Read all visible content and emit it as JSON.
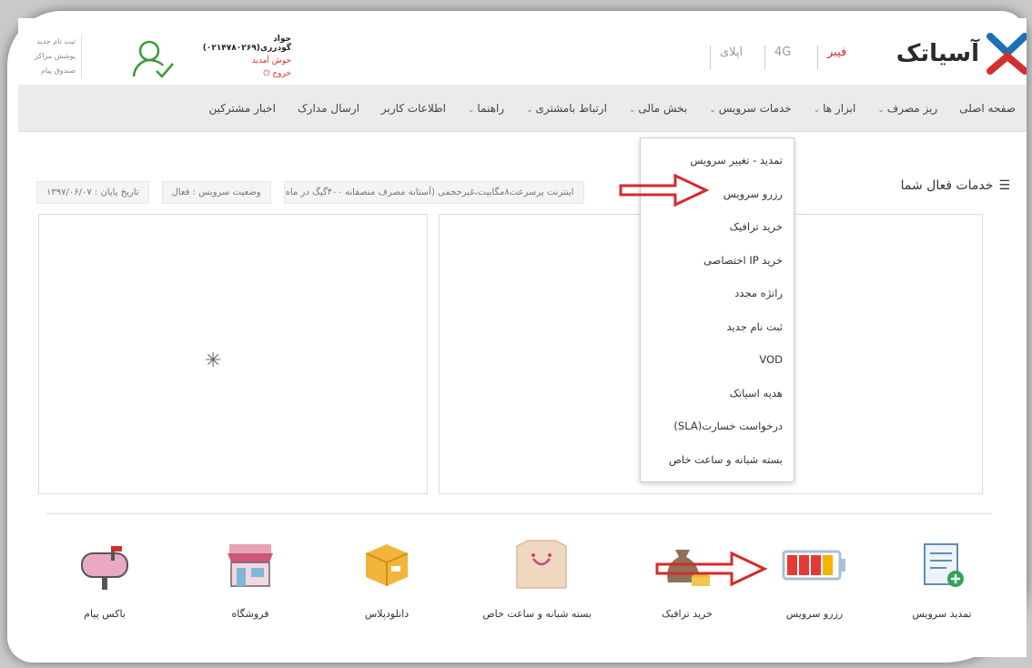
{
  "header": {
    "brand": "آسیاتک",
    "partner1": "اپلای",
    "partner2": "4G",
    "partner3": "فیبر",
    "left_links": [
      "ثبت نام جدید",
      "پوشش مراکز",
      "صندوق پیام"
    ],
    "user_name": "جواد گودرزی(۰۲۱۴۷۸۰۲۶۹)",
    "welcome": "خوش آمدید",
    "logout": "خروج"
  },
  "nav": {
    "items": [
      {
        "label": "صفحه اصلی",
        "caret": false
      },
      {
        "label": "ریز مصرف",
        "caret": true
      },
      {
        "label": "ابزار ها",
        "caret": true
      },
      {
        "label": "خدمات سرویس",
        "caret": true
      },
      {
        "label": "بخش مالی",
        "caret": true
      },
      {
        "label": "ارتباط بامشتری",
        "caret": true
      },
      {
        "label": "راهنما",
        "caret": true
      },
      {
        "label": "اطلاعات کاربر",
        "caret": false
      },
      {
        "label": "ارسال مدارک",
        "caret": false
      },
      {
        "label": "اخبار مشترکین",
        "caret": false
      }
    ]
  },
  "content": {
    "services_title": "خدمات فعال شما",
    "service_desc": "اینترنت پرسرعت۸مگابیت،غیرحجمی (آستانه مصرف منصفانه ۴۰۰گیگ در ماه)",
    "status": "وضعیت سرویس : فعال",
    "end_date": "تاریخ پایان : ۱۳۹۷/۰۶/۰۷"
  },
  "dropdown": {
    "items": [
      "تمدید - تغییر سرویس",
      "رزرو سرویس",
      "خرید ترافیک",
      "خرید IP اختصاصی",
      "رانژه مجدد",
      "ثبت نام جدید",
      "VOD",
      "هدیه اسیاتک",
      "درخواست خسارت(SLA)",
      "بسته شبانه و ساعت خاص"
    ]
  },
  "shortcuts": [
    {
      "label": "تمدید سرویس",
      "icon": "renew-service-icon"
    },
    {
      "label": "رزرو سرویس",
      "icon": "battery-icon"
    },
    {
      "label": "خرید ترافیک",
      "icon": "money-bag-icon"
    },
    {
      "label": "بسته شبانه و ساعت خاص",
      "icon": "gift-box-icon"
    },
    {
      "label": "دانلودپلاس",
      "icon": "download-box-icon"
    },
    {
      "label": "فروشگاه",
      "icon": "store-icon"
    },
    {
      "label": "باکس پیام",
      "icon": "mailbox-icon"
    }
  ],
  "colors": {
    "brand_blue": "#1e6fb8",
    "brand_red": "#d0302e",
    "arrow_red": "#d62a2a"
  }
}
